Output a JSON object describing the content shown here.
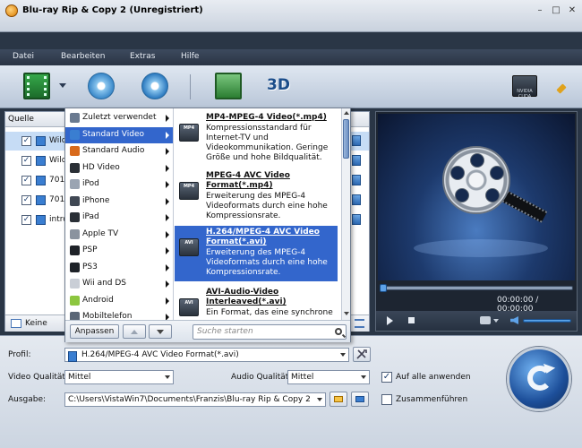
{
  "window": {
    "title": "Blu-ray Rip & Copy 2 (Unregistriert)",
    "controls": [
      "–",
      "□",
      "✕"
    ]
  },
  "menu": [
    "Datei",
    "Bearbeiten",
    "Extras",
    "Hilfe"
  ],
  "toolbar": {
    "three_d_label": "3D",
    "cuda_label": "NVIDIA CUDA"
  },
  "file_list": {
    "header": "Quelle",
    "rows": [
      {
        "name": "Wild",
        "checked": true,
        "selected": true
      },
      {
        "name": "Wild",
        "checked": true,
        "selected": false
      },
      {
        "name": "701",
        "checked": true,
        "selected": false
      },
      {
        "name": "701",
        "checked": true,
        "selected": false
      },
      {
        "name": "intro",
        "checked": true,
        "selected": false
      }
    ],
    "subtitle": "Keine"
  },
  "popup": {
    "categories": [
      {
        "label": "Zuletzt verwendet",
        "icon_color": "#6a7a90",
        "active": false
      },
      {
        "label": "Standard Video",
        "icon_color": "#3a7ed1",
        "active": true
      },
      {
        "label": "Standard Audio",
        "icon_color": "#d86a1c",
        "active": false
      },
      {
        "label": "HD Video",
        "icon_color": "#2a2f36",
        "active": false
      },
      {
        "label": "iPod",
        "icon_color": "#9aa4b2",
        "active": false
      },
      {
        "label": "iPhone",
        "icon_color": "#404854",
        "active": false
      },
      {
        "label": "iPad",
        "icon_color": "#2a2f36",
        "active": false
      },
      {
        "label": "Apple TV",
        "icon_color": "#8a939f",
        "active": false
      },
      {
        "label": "PSP",
        "icon_color": "#1e2228",
        "active": false
      },
      {
        "label": "PS3",
        "icon_color": "#1e2228",
        "active": false
      },
      {
        "label": "Wii and DS",
        "icon_color": "#c9ced6",
        "active": false
      },
      {
        "label": "Android",
        "icon_color": "#8cc63f",
        "active": false
      },
      {
        "label": "Mobiltelefon",
        "icon_color": "#5a6676",
        "active": false
      }
    ],
    "formats": [
      {
        "badge": "MP4",
        "title": "MP4-MPEG-4 Video(*.mp4)",
        "desc": "Kompressionsstandard für Internet-TV und Videokommunikation. Geringe Größe und hohe Bildqualität.",
        "active": false
      },
      {
        "badge": "MP4",
        "title": "MPEG-4 AVC Video Format(*.mp4)",
        "desc": "Erweiterung des MPEG-4 Videoformats durch eine hohe Kompressionsrate.",
        "active": false
      },
      {
        "badge": "AVI",
        "title": "H.264/MPEG-4 AVC Video Format(*.avi)",
        "desc": "Erweiterung des MPEG-4 Videoformats durch eine hohe Kompressionsrate.",
        "active": true
      },
      {
        "badge": "AVI",
        "title": "AVI-Audio-Video Interleaved(*.avi)",
        "desc": "Ein Format, das eine synchrone",
        "active": false
      }
    ],
    "customize_label": "Anpassen",
    "search_placeholder": "Suche starten"
  },
  "preview": {
    "time": "00:00:00 / 00:00:00"
  },
  "settings": {
    "profile_label": "Profil:",
    "profile_value": "H.264/MPEG-4 AVC Video Format(*.avi)",
    "video_quality_label": "Video Qualität:",
    "video_quality_value": "Mittel",
    "audio_quality_label": "Audio Qualität:",
    "audio_quality_value": "Mittel",
    "apply_all_label": "Auf alle anwenden",
    "apply_all_checked": true,
    "output_label": "Ausgabe:",
    "output_value": "C:\\Users\\VistaWin7\\Documents\\Franzis\\Blu-ray Rip & Copy 2",
    "merge_label": "Zusammenführen",
    "merge_checked": false
  }
}
